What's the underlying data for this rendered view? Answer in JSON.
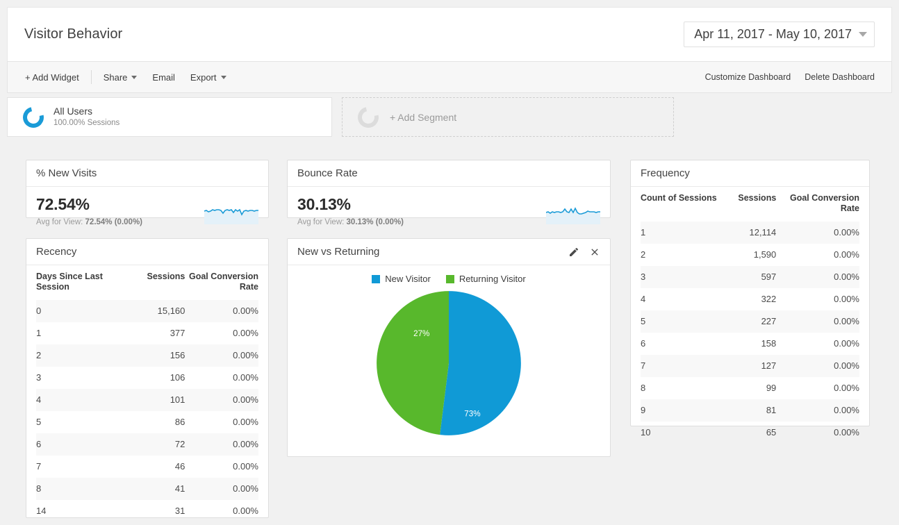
{
  "header": {
    "title": "Visitor Behavior",
    "date_range": "Apr 11, 2017 - May 10, 2017"
  },
  "toolbar": {
    "left_items": [
      {
        "label": "+ Add Widget",
        "has_caret": false
      },
      {
        "label": "Share",
        "has_caret": true
      },
      {
        "label": "Email",
        "has_caret": false
      },
      {
        "label": "Export",
        "has_caret": true
      }
    ],
    "right_items": [
      {
        "label": "Customize Dashboard"
      },
      {
        "label": "Delete Dashboard"
      }
    ]
  },
  "segments": {
    "applied": {
      "name": "All Users",
      "sub": "100.00% Sessions",
      "icon": "donut-icon"
    },
    "add": {
      "label": "+ Add Segment",
      "icon": "donut-icon"
    }
  },
  "widgets": {
    "new_visits": {
      "title": "% New Visits",
      "value": "72.54%",
      "avg_prefix": "Avg for View: ",
      "avg_value": "72.54% (0.00%)"
    },
    "bounce_rate": {
      "title": "Bounce Rate",
      "value": "30.13%",
      "avg_prefix": "Avg for View: ",
      "avg_value": "30.13% (0.00%)"
    },
    "frequency": {
      "title": "Frequency",
      "columns": [
        "Count of Sessions",
        "Sessions",
        "Goal Conversion Rate"
      ],
      "rows": [
        [
          "1",
          "12,114",
          "0.00%"
        ],
        [
          "2",
          "1,590",
          "0.00%"
        ],
        [
          "3",
          "597",
          "0.00%"
        ],
        [
          "4",
          "322",
          "0.00%"
        ],
        [
          "5",
          "227",
          "0.00%"
        ],
        [
          "6",
          "158",
          "0.00%"
        ],
        [
          "7",
          "127",
          "0.00%"
        ],
        [
          "8",
          "99",
          "0.00%"
        ],
        [
          "9",
          "81",
          "0.00%"
        ],
        [
          "10",
          "65",
          "0.00%"
        ]
      ]
    },
    "recency": {
      "title": "Recency",
      "columns": [
        "Days Since Last Session",
        "Sessions",
        "Goal Conversion Rate"
      ],
      "rows": [
        [
          "0",
          "15,160",
          "0.00%"
        ],
        [
          "1",
          "377",
          "0.00%"
        ],
        [
          "2",
          "156",
          "0.00%"
        ],
        [
          "3",
          "106",
          "0.00%"
        ],
        [
          "4",
          "101",
          "0.00%"
        ],
        [
          "5",
          "86",
          "0.00%"
        ],
        [
          "6",
          "72",
          "0.00%"
        ],
        [
          "7",
          "46",
          "0.00%"
        ],
        [
          "8",
          "41",
          "0.00%"
        ],
        [
          "14",
          "31",
          "0.00%"
        ]
      ]
    },
    "new_vs_returning": {
      "title": "New vs Returning",
      "edit_icon": "pencil-icon",
      "close_icon": "close-icon"
    }
  },
  "colors": {
    "blue": "#109ad6",
    "green": "#58b82c",
    "page_bg": "#f1f1f1",
    "spark_line": "#1a9bd7",
    "spark_fill": "#e4f1f9"
  },
  "chart_data": {
    "type": "pie",
    "title": "New vs Returning",
    "categories": [
      "New Visitor",
      "Returning Visitor"
    ],
    "values": [
      73,
      27
    ],
    "labels": [
      "73%",
      "27%"
    ],
    "colors": [
      "#109ad6",
      "#58b82c"
    ],
    "legend_position": "top",
    "start_angle": 0,
    "direction": "clockwise"
  }
}
